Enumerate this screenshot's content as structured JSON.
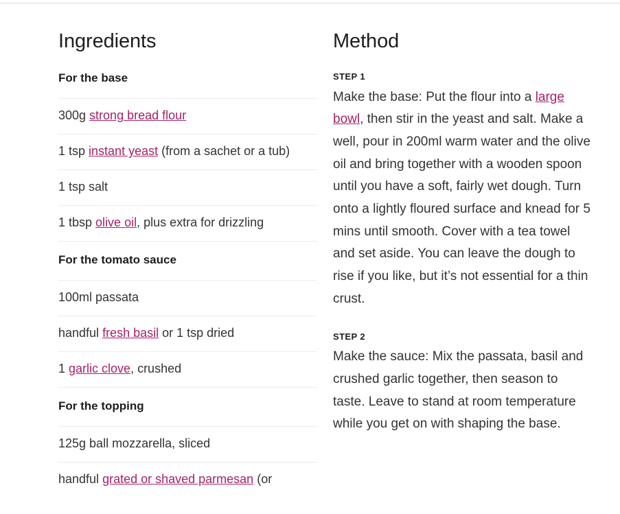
{
  "page": {
    "accent_link_color": "#a6216a",
    "text_color": "#333333",
    "heading_color": "#1d1d1b",
    "divider_color": "#ececec"
  },
  "ingredients": {
    "heading": "Ingredients",
    "groups": [
      {
        "heading": "For the base",
        "items": [
          {
            "pre": "300g ",
            "link": "strong bread flour",
            "post": ""
          },
          {
            "pre": "1 tsp ",
            "link": "instant yeast",
            "post": " (from a sachet or a tub)"
          },
          {
            "pre": "1 tsp salt",
            "link": "",
            "post": ""
          },
          {
            "pre": "1 tbsp ",
            "link": "olive oil",
            "post": ", plus extra for drizzling"
          }
        ]
      },
      {
        "heading": "For the tomato sauce",
        "items": [
          {
            "pre": "100ml passata",
            "link": "",
            "post": ""
          },
          {
            "pre": "handful ",
            "link": "fresh basil",
            "post": " or 1 tsp dried"
          },
          {
            "pre": "1 ",
            "link": "garlic clove",
            "post": ", crushed"
          }
        ]
      },
      {
        "heading": "For the topping",
        "items": [
          {
            "pre": "125g ball mozzarella, sliced",
            "link": "",
            "post": ""
          },
          {
            "pre": "handful ",
            "link": "grated or shaved parmesan",
            "post": " (or"
          }
        ]
      }
    ]
  },
  "method": {
    "heading": "Method",
    "steps": [
      {
        "label": "STEP 1",
        "pre": "Make the base: Put the flour into a ",
        "link": "large bowl",
        "post": ", then stir in the yeast and salt. Make a well, pour in 200ml warm water and the olive oil and bring together with a wooden spoon until you have a soft, fairly wet dough. Turn onto a lightly floured surface and knead for 5 mins until smooth. Cover with a tea towel and set aside. You can leave the dough to rise if you like, but it’s not essential for a thin crust."
      },
      {
        "label": "STEP 2",
        "pre": "Make the sauce: Mix the passata, basil and crushed garlic together, then season to taste. Leave to stand at room temperature while you get on with shaping the base.",
        "link": "",
        "post": ""
      }
    ]
  }
}
